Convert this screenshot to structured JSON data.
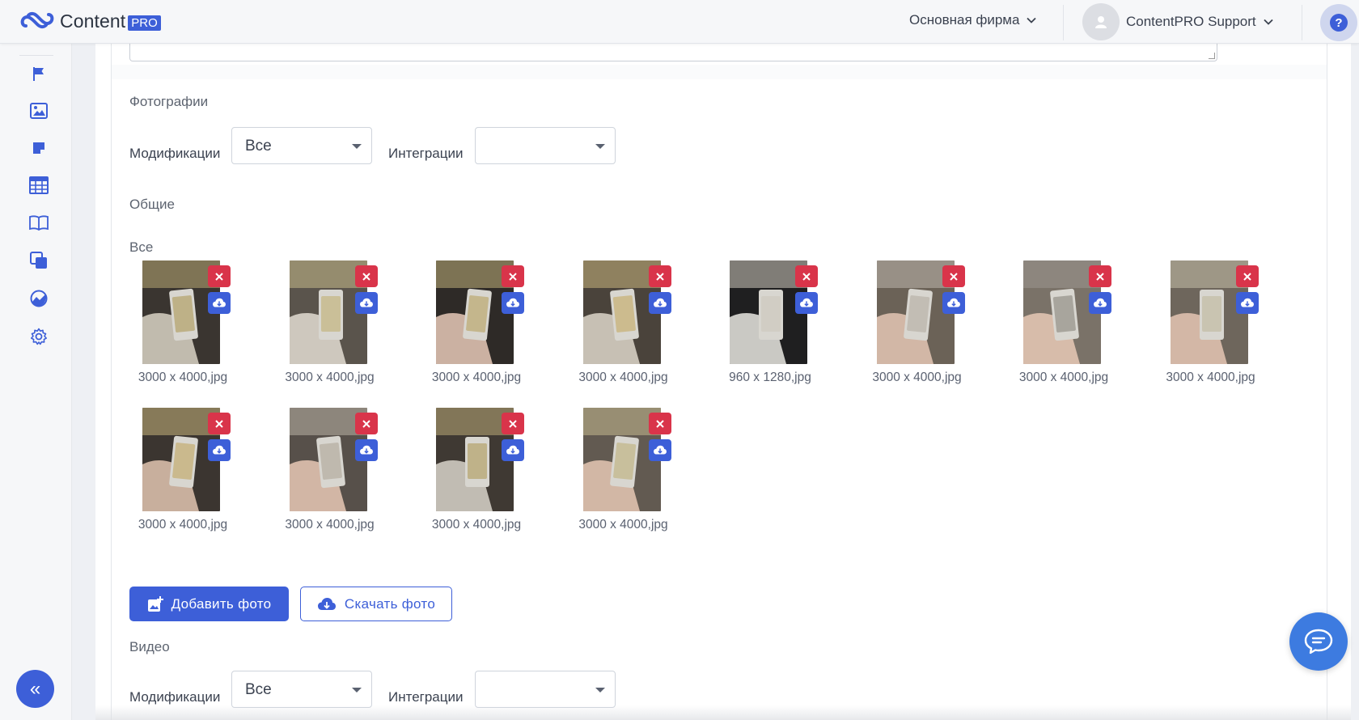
{
  "app": {
    "logo_text": "Content",
    "logo_badge": "PRO",
    "brand_color": "#3d5fd8"
  },
  "header": {
    "company": "Основная фирма",
    "user_name": "ContentPRO Support",
    "help_label": "?"
  },
  "sidebar": {
    "icons": [
      "flag-icon",
      "image-icon",
      "note-icon",
      "table-icon",
      "book-icon",
      "copy-icon",
      "analytics-icon",
      "settings-icon"
    ],
    "collapse_label": "«"
  },
  "photos_section": {
    "title": "Фотографии",
    "modifications_label": "Модификации",
    "modifications_value": "Все",
    "integrations_label": "Интеграции",
    "integrations_value": "",
    "general_title": "Общие",
    "group_title": "Все",
    "items": [
      {
        "caption": "3000 x 4000,jpg"
      },
      {
        "caption": "3000 x 4000,jpg"
      },
      {
        "caption": "3000 x 4000,jpg"
      },
      {
        "caption": "3000 x 4000,jpg"
      },
      {
        "caption": "960 x 1280,jpg"
      },
      {
        "caption": "3000 x 4000,jpg"
      },
      {
        "caption": "3000 x 4000,jpg"
      },
      {
        "caption": "3000 x 4000,jpg"
      },
      {
        "caption": "3000 x 4000,jpg"
      },
      {
        "caption": "3000 x 4000,jpg"
      },
      {
        "caption": "3000 x 4000,jpg"
      },
      {
        "caption": "3000 x 4000,jpg"
      }
    ],
    "add_button": "Добавить фото",
    "download_button": "Скачать фото"
  },
  "video_section": {
    "title": "Видео",
    "modifications_label": "Модификации",
    "modifications_value": "Все",
    "integrations_label": "Интеграции",
    "integrations_value": ""
  },
  "colors": {
    "accent": "#3d5fd8",
    "danger": "#d9344a",
    "chat": "#3d7be0"
  }
}
